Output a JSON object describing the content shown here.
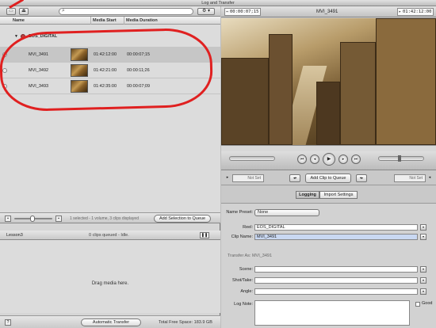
{
  "window": {
    "title": "Log and Transfer"
  },
  "browser": {
    "columns": [
      "Name",
      "Media Start",
      "Media Duration"
    ],
    "volume": "EOS_DIGITAL",
    "clips": [
      {
        "name": "MVI_3491",
        "start": "01:42:12:00",
        "duration": "00:00:07;15"
      },
      {
        "name": "MVI_3492",
        "start": "01:42:21:00",
        "duration": "00:00:11;26"
      },
      {
        "name": "MVI_3493",
        "start": "01:42:35:00",
        "duration": "00:00:07;09"
      }
    ],
    "footer_info": "1 selected - 1 volume, 3 clips displayed",
    "add_selection_label": "Add Selection to Queue"
  },
  "queue": {
    "name": "Lesson3",
    "status": "0 clips queued - Idle.",
    "drop_hint": "Drag media here.",
    "auto_transfer_label": "Automatic Transfer",
    "free_space": "Total Free Space: 183.9 GB"
  },
  "viewer": {
    "duration_tc": "00:00:07;15",
    "clip_name": "MVI_3491",
    "current_tc": "01:42:12:00",
    "in_point": "Not Set",
    "out_point": "Not Set",
    "add_clip_label": "Add Clip to Queue"
  },
  "tabs": [
    "Logging",
    "Import Settings"
  ],
  "logging": {
    "name_preset_label": "Name Preset:",
    "name_preset_value": "None",
    "reel_label": "Reel:",
    "reel_value": "EOS_DIGITAL",
    "clip_name_label": "Clip Name:",
    "clip_name_value": "MVI_3491",
    "transfer_as": "Transfer As:  MVI_3491",
    "scene_label": "Scene:",
    "shot_label": "Shot/Take:",
    "angle_label": "Angle:",
    "log_note_label": "Log Note:",
    "good_label": "Good"
  },
  "colors": {
    "annotation": "#e02020"
  }
}
